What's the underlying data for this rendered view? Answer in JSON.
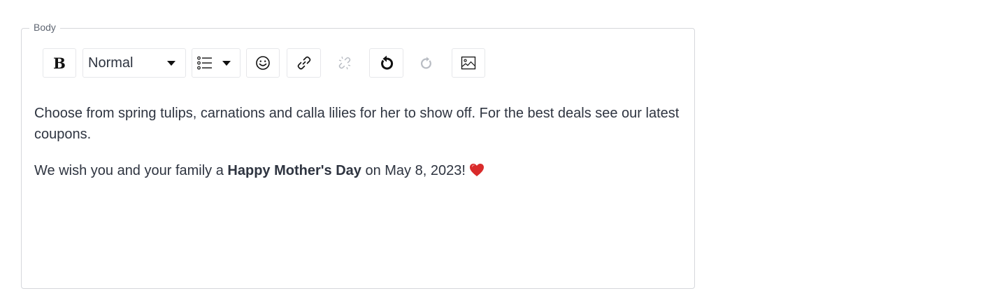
{
  "field": {
    "label": "Body"
  },
  "toolbar": {
    "bold_label": "B",
    "heading_select": {
      "selected": "Normal"
    },
    "buttons": [
      {
        "icon": "bold-icon"
      },
      {
        "icon": "heading-select"
      },
      {
        "icon": "list-icon"
      },
      {
        "icon": "emoji-icon"
      },
      {
        "icon": "link-icon"
      },
      {
        "icon": "unlink-icon",
        "disabled": true
      },
      {
        "icon": "undo-icon"
      },
      {
        "icon": "redo-icon",
        "disabled": true
      },
      {
        "icon": "image-icon"
      }
    ]
  },
  "content": {
    "paragraph1": "Choose from spring tulips, carnations and calla lilies for her to show off. For the best deals see our latest coupons.",
    "paragraph2_before": "We wish you and your family a ",
    "paragraph2_bold": "Happy Mother's Day",
    "paragraph2_after": " on May 8, 2023! ",
    "paragraph2_emoji": "heart-icon"
  },
  "colors": {
    "text": "#2e3440",
    "border": "#d5d7db",
    "heart": "#d92b2b",
    "disabled_icon": "#b8bcc3"
  }
}
